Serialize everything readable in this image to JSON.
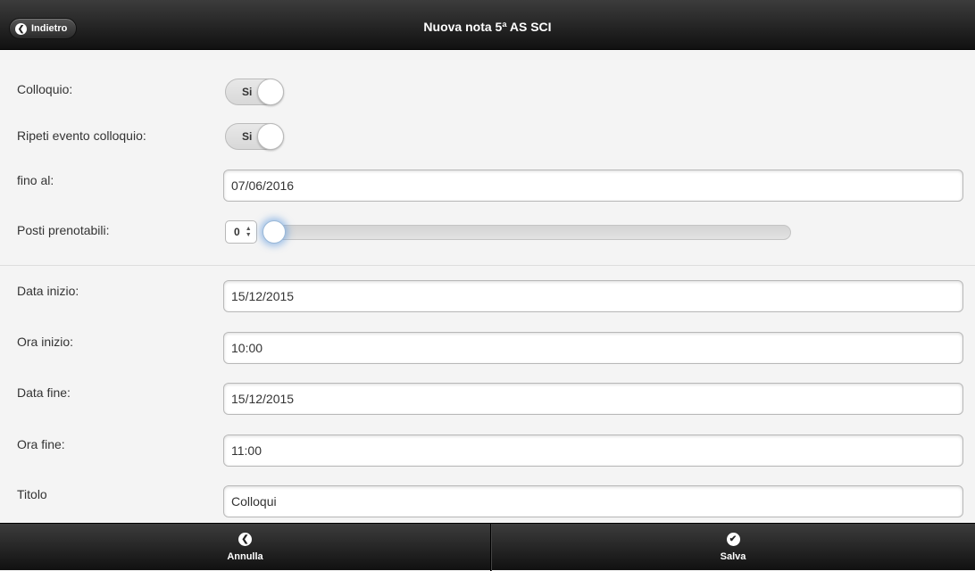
{
  "header": {
    "back_label": "Indietro",
    "title": "Nuova nota 5ª AS SCI"
  },
  "form": {
    "colloquio": {
      "label": "Colloquio:",
      "toggle_value": "Si"
    },
    "ripeti": {
      "label": "Ripeti evento colloquio:",
      "toggle_value": "Si"
    },
    "fino_al": {
      "label": "fino al:",
      "value": "07/06/2016"
    },
    "posti": {
      "label": "Posti prenotabili:",
      "value": "0",
      "slider_fraction": 0
    },
    "data_inizio": {
      "label": "Data inizio:",
      "value": "15/12/2015"
    },
    "ora_inizio": {
      "label": "Ora inizio:",
      "value": "10:00"
    },
    "data_fine": {
      "label": "Data fine:",
      "value": "15/12/2015"
    },
    "ora_fine": {
      "label": "Ora fine:",
      "value": "11:00"
    },
    "titolo": {
      "label": "Titolo",
      "value": "Colloqui"
    }
  },
  "footer": {
    "cancel_label": "Annulla",
    "cancel_icon": "chevron-left-icon",
    "save_label": "Salva",
    "save_icon": "check-icon"
  }
}
